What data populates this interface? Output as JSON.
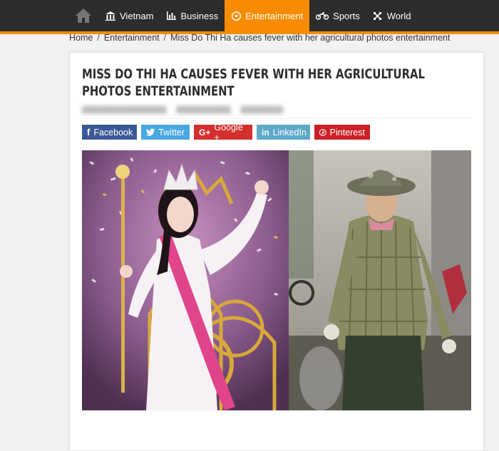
{
  "nav": {
    "items": [
      {
        "label": "Vietnam",
        "icon": "bank-icon"
      },
      {
        "label": "Business",
        "icon": "bar-chart-icon"
      },
      {
        "label": "Entertainment",
        "icon": "soccer-ball-icon",
        "active": true
      },
      {
        "label": "Sports",
        "icon": "motorcycle-icon"
      },
      {
        "label": "World",
        "icon": "globe-icon"
      }
    ],
    "accent_color": "#f88c00",
    "bar_color": "#2d2d2d"
  },
  "breadcrumb": {
    "home": "Home",
    "section": "Entertainment",
    "current": "Miss Do Thi Ha causes fever with her agricultural photos entertainment",
    "separator": "/"
  },
  "article": {
    "title": "Miss Do Thi Ha causes fever with her agricultural photos entertainment"
  },
  "share": {
    "facebook": "Facebook",
    "twitter": "Twitter",
    "google": "Google +",
    "linkedin": "LinkedIn",
    "pinterest": "Pinterest"
  }
}
